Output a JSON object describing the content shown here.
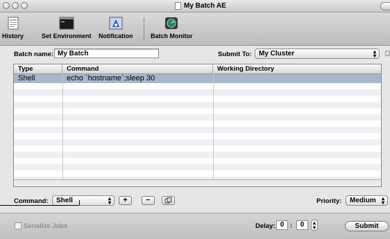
{
  "window": {
    "title": "My Batch AE"
  },
  "toolbar": {
    "items": [
      {
        "label": "History",
        "icon": "history-icon"
      },
      {
        "label": "Set Environment",
        "icon": "terminal-icon"
      },
      {
        "label": "Notification",
        "icon": "notification-icon"
      },
      {
        "label": "Batch Monitor",
        "icon": "batch-monitor-icon"
      }
    ]
  },
  "form": {
    "batch_name_label": "Batch name:",
    "batch_name_value": "My Batch",
    "submit_to_label": "Submit To:",
    "submit_to_value": "My Cluster"
  },
  "table": {
    "columns": [
      "Type",
      "Command",
      "Working Directory"
    ],
    "rows": [
      {
        "type": "Shell",
        "command": "echo `hostname`;sleep 30",
        "working_directory": ""
      }
    ]
  },
  "command_bar": {
    "command_label": "Command:",
    "command_value": "Shell",
    "add_label": "+",
    "remove_label": "−",
    "priority_label": "Priority:",
    "priority_value": "Medium"
  },
  "bottom": {
    "serialize_label": "Serialize Jobs",
    "delay_label": "Delay:",
    "delay_first": "0",
    "delay_separator": ":",
    "delay_second": "0",
    "submit_label": "Submit"
  }
}
